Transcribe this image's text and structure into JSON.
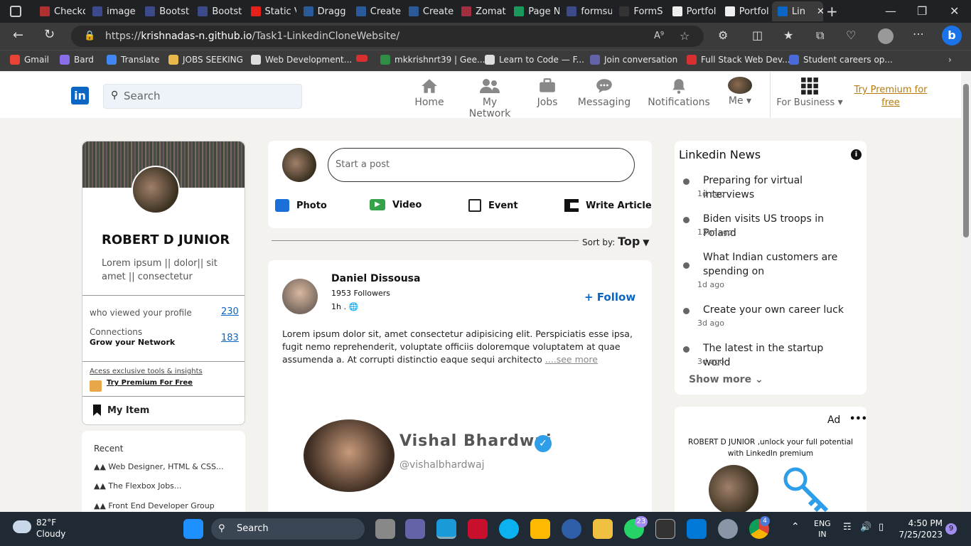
{
  "browser": {
    "tabs": [
      "Checkc",
      "image",
      "Bootst",
      "Bootst",
      "Static V",
      "Dragg",
      "Create",
      "Create",
      "Zomat",
      "Page N",
      "formsu",
      "FormS",
      "Portfol",
      "Portfol",
      "Lin"
    ],
    "url_prefix": "https://",
    "url_domain": "krishnadas-n.github.io",
    "url_path": "/Task1-LinkedinCloneWebsite/",
    "bookmarks": [
      "Gmail",
      "Bard",
      "Translate",
      "JOBS SEEKING",
      "Web Development...",
      "",
      "mkkrishnrt39 | Gee...",
      "Learn to Code — F...",
      "Join conversation",
      "Full Stack Web Dev...",
      "Student careers op..."
    ]
  },
  "nav": {
    "logo": "in",
    "search_placeholder": "Search",
    "items": [
      "Home",
      "My Network",
      "Jobs",
      "Messaging",
      "Notifications",
      "Me"
    ],
    "business": "For Business",
    "premium_line1": "Try Premium for",
    "premium_line2": "free"
  },
  "profile": {
    "name": "ROBERT D JUNIOR",
    "tagline": "Lorem ipsum || dolor|| sit amet || consectetur",
    "viewed_label": "who viewed your profile",
    "viewed_value": "230",
    "connections_label": "Connections",
    "grow_label": "Grow your Network",
    "connections_value": "183",
    "exclusive": "Acess exclusive tools & insights",
    "try_premium": "Try Premium For Free",
    "my_item": "My Item"
  },
  "recent": {
    "title": "Recent",
    "items": [
      "Web Designer, HTML & CSS...",
      "The Flexbox Jobs...",
      "Front End Developer Group"
    ]
  },
  "composer": {
    "placeholder": "Start a post",
    "actions": [
      "Photo",
      "Video",
      "Event",
      "Write Article"
    ]
  },
  "sort": {
    "label": "Sort by:",
    "value": "Top"
  },
  "post": {
    "author": "Daniel Dissousa",
    "followers": "1953 Followers",
    "time": "1h .",
    "follow": "+ Follow",
    "text": "Lorem ipsum dolor sit, amet consectetur adipisicing elit. Perspiciatis esse ipsa, fugit nemo reprehenderit, voluptate officiis doloremque voluptatem at quae assumenda a. At corrupti distinctio eaque sequi architecto",
    "see_more": "....see more",
    "image_name": "Vishal Bhardwaj",
    "image_handle": "@vishalbhardwaj"
  },
  "news": {
    "title": "Linkedin News",
    "items": [
      {
        "title": "Preparing for virtual interviews",
        "age": "1d ago"
      },
      {
        "title": "Biden visits US troops in Poland",
        "age": "13hr ago"
      },
      {
        "title": "What Indian customers are spending on",
        "age": "1d ago"
      },
      {
        "title": "Create your own career luck",
        "age": "3d ago"
      },
      {
        "title": "The latest in the startup world",
        "age": "3d ago"
      }
    ],
    "show_more": "Show more"
  },
  "ad": {
    "label": "Ad",
    "more": "•••",
    "text": "ROBERT D JUNIOR ,unlock your full potential with LinkedIn premium"
  },
  "taskbar": {
    "temp": "82°F",
    "weather": "Cloudy",
    "search": "Search",
    "lang1": "ENG",
    "lang2": "IN",
    "time": "4:50 PM",
    "date": "7/25/2023",
    "badge_whatsapp": "23",
    "badge_chrome": "4",
    "notif": "9"
  },
  "colors": {
    "linkedin_blue": "#0a66c2",
    "premium_gold": "#b57b10"
  }
}
